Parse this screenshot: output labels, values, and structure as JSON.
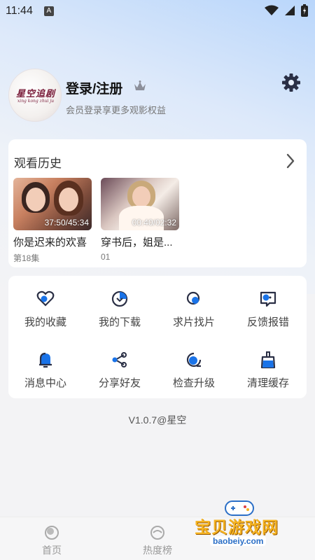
{
  "status_bar": {
    "time": "11:44",
    "badge": "A"
  },
  "profile": {
    "avatar_title": "星空追剧",
    "avatar_subtitle": "xing kong zhui ju",
    "login_title": "登录/注册",
    "login_subtitle": "会员登录享更多观影权益"
  },
  "history": {
    "title": "观看历史",
    "items": [
      {
        "time": "37:50/45:34",
        "title": "你是迟来的欢喜",
        "episode": "第18集"
      },
      {
        "time": "00:40/02:32",
        "title": "穿书后，姐是...",
        "episode": "01"
      }
    ]
  },
  "features": [
    {
      "label": "我的收藏",
      "icon": "heart-icon"
    },
    {
      "label": "我的下载",
      "icon": "download-icon"
    },
    {
      "label": "求片找片",
      "icon": "search-film-icon"
    },
    {
      "label": "反馈报错",
      "icon": "feedback-icon"
    },
    {
      "label": "消息中心",
      "icon": "bell-icon"
    },
    {
      "label": "分享好友",
      "icon": "share-icon"
    },
    {
      "label": "检查升级",
      "icon": "upgrade-icon"
    },
    {
      "label": "清理缓存",
      "icon": "broom-icon"
    }
  ],
  "version": "V1.0.7@星空",
  "bottom_nav": [
    {
      "label": "首页",
      "icon": "home-icon"
    },
    {
      "label": "热度榜",
      "icon": "hot-rank-icon"
    }
  ],
  "watermark": {
    "text": "宝贝游戏网",
    "url": "baobeiy.com"
  },
  "colors": {
    "accent": "#1a73e8",
    "icon_dark": "#2a2f45"
  }
}
